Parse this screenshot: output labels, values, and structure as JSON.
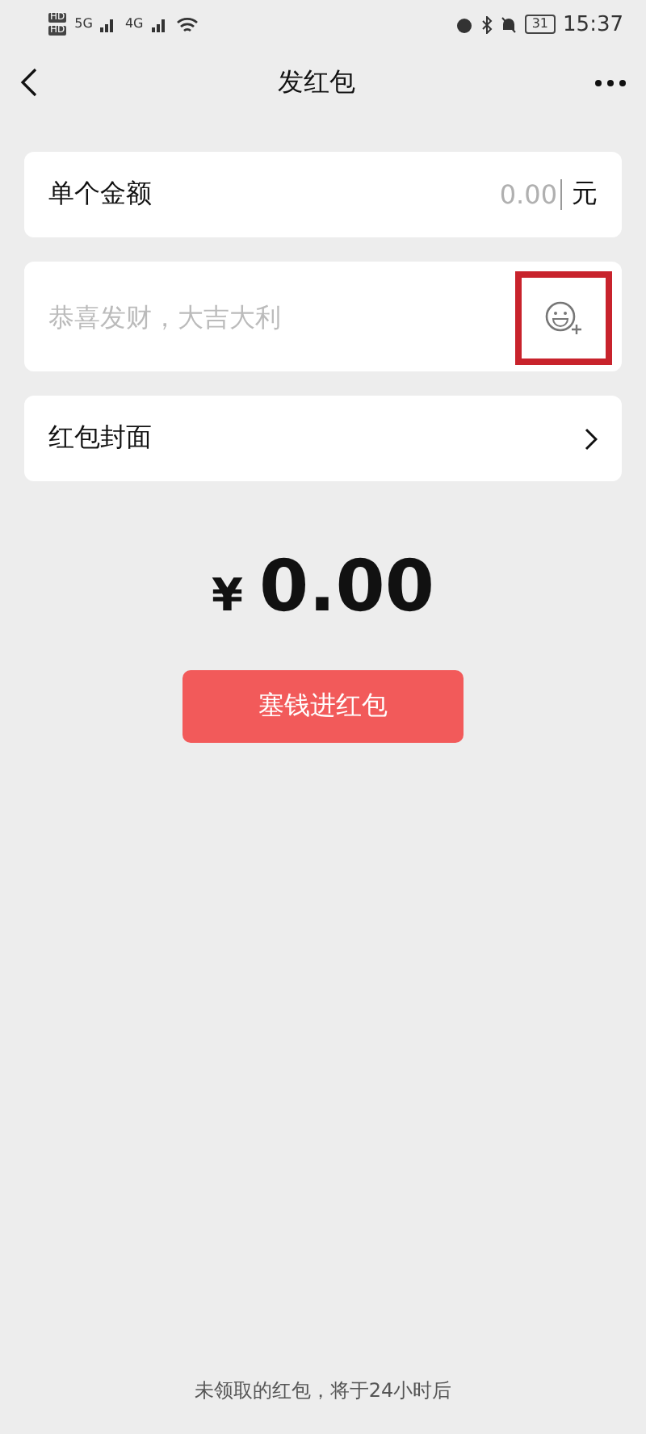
{
  "status_bar": {
    "sim_labels": [
      "HD",
      "HD"
    ],
    "networks": [
      "5G",
      "4G"
    ],
    "battery": "31",
    "time": "15:37"
  },
  "nav": {
    "title": "发红包"
  },
  "amount_row": {
    "label": "单个金额",
    "value": "0.00",
    "unit": "元"
  },
  "greeting": {
    "placeholder": "恭喜发财，大吉大利",
    "emoji_highlighted": true
  },
  "cover_row": {
    "label": "红包封面"
  },
  "total": {
    "currency": "¥",
    "amount": "0.00"
  },
  "submit": {
    "label": "塞钱进红包"
  },
  "footer": {
    "note": "未领取的红包，将于24小时后"
  }
}
